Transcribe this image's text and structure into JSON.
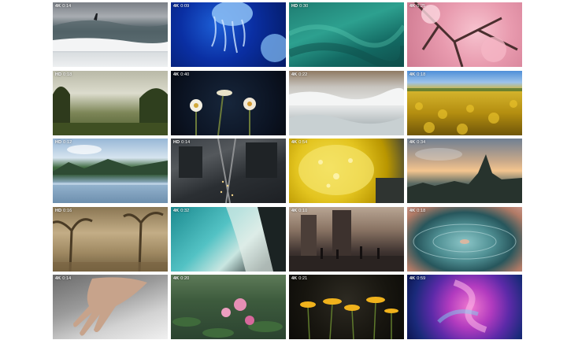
{
  "videos": [
    {
      "quality": "4K",
      "duration": "0:14",
      "subject": "surfing-wave"
    },
    {
      "quality": "4K",
      "duration": "0:09",
      "subject": "jellyfish"
    },
    {
      "quality": "HD",
      "duration": "0:30",
      "subject": "underwater-kelp"
    },
    {
      "quality": "4K",
      "duration": "0:25",
      "subject": "cherry-blossom"
    },
    {
      "quality": "HD",
      "duration": "0:18",
      "subject": "foggy-meadow"
    },
    {
      "quality": "4K",
      "duration": "0:40",
      "subject": "blooming-flowers"
    },
    {
      "quality": "4K",
      "duration": "0:22",
      "subject": "ice-waves"
    },
    {
      "quality": "4K",
      "duration": "0:18",
      "subject": "sunflower-field"
    },
    {
      "quality": "HD",
      "duration": "0:12",
      "subject": "mountain-lake"
    },
    {
      "quality": "HD",
      "duration": "0:14",
      "subject": "city-aerial"
    },
    {
      "quality": "4K",
      "duration": "0:54",
      "subject": "lemon-bubbles"
    },
    {
      "quality": "4K",
      "duration": "0:34",
      "subject": "taipei-skyline"
    },
    {
      "quality": "HD",
      "duration": "0:16",
      "subject": "misty-forest"
    },
    {
      "quality": "4K",
      "duration": "0:32",
      "subject": "tropical-beach"
    },
    {
      "quality": "4K",
      "duration": "0:10",
      "subject": "city-street"
    },
    {
      "quality": "4K",
      "duration": "0:18",
      "subject": "vinyl-record"
    },
    {
      "quality": "4K",
      "duration": "0:14",
      "subject": "sand-hand"
    },
    {
      "quality": "4K",
      "duration": "0:20",
      "subject": "lotus-pond"
    },
    {
      "quality": "4K",
      "duration": "0:21",
      "subject": "yellow-flowers"
    },
    {
      "quality": "4K",
      "duration": "0:59",
      "subject": "ink-smoke"
    }
  ]
}
